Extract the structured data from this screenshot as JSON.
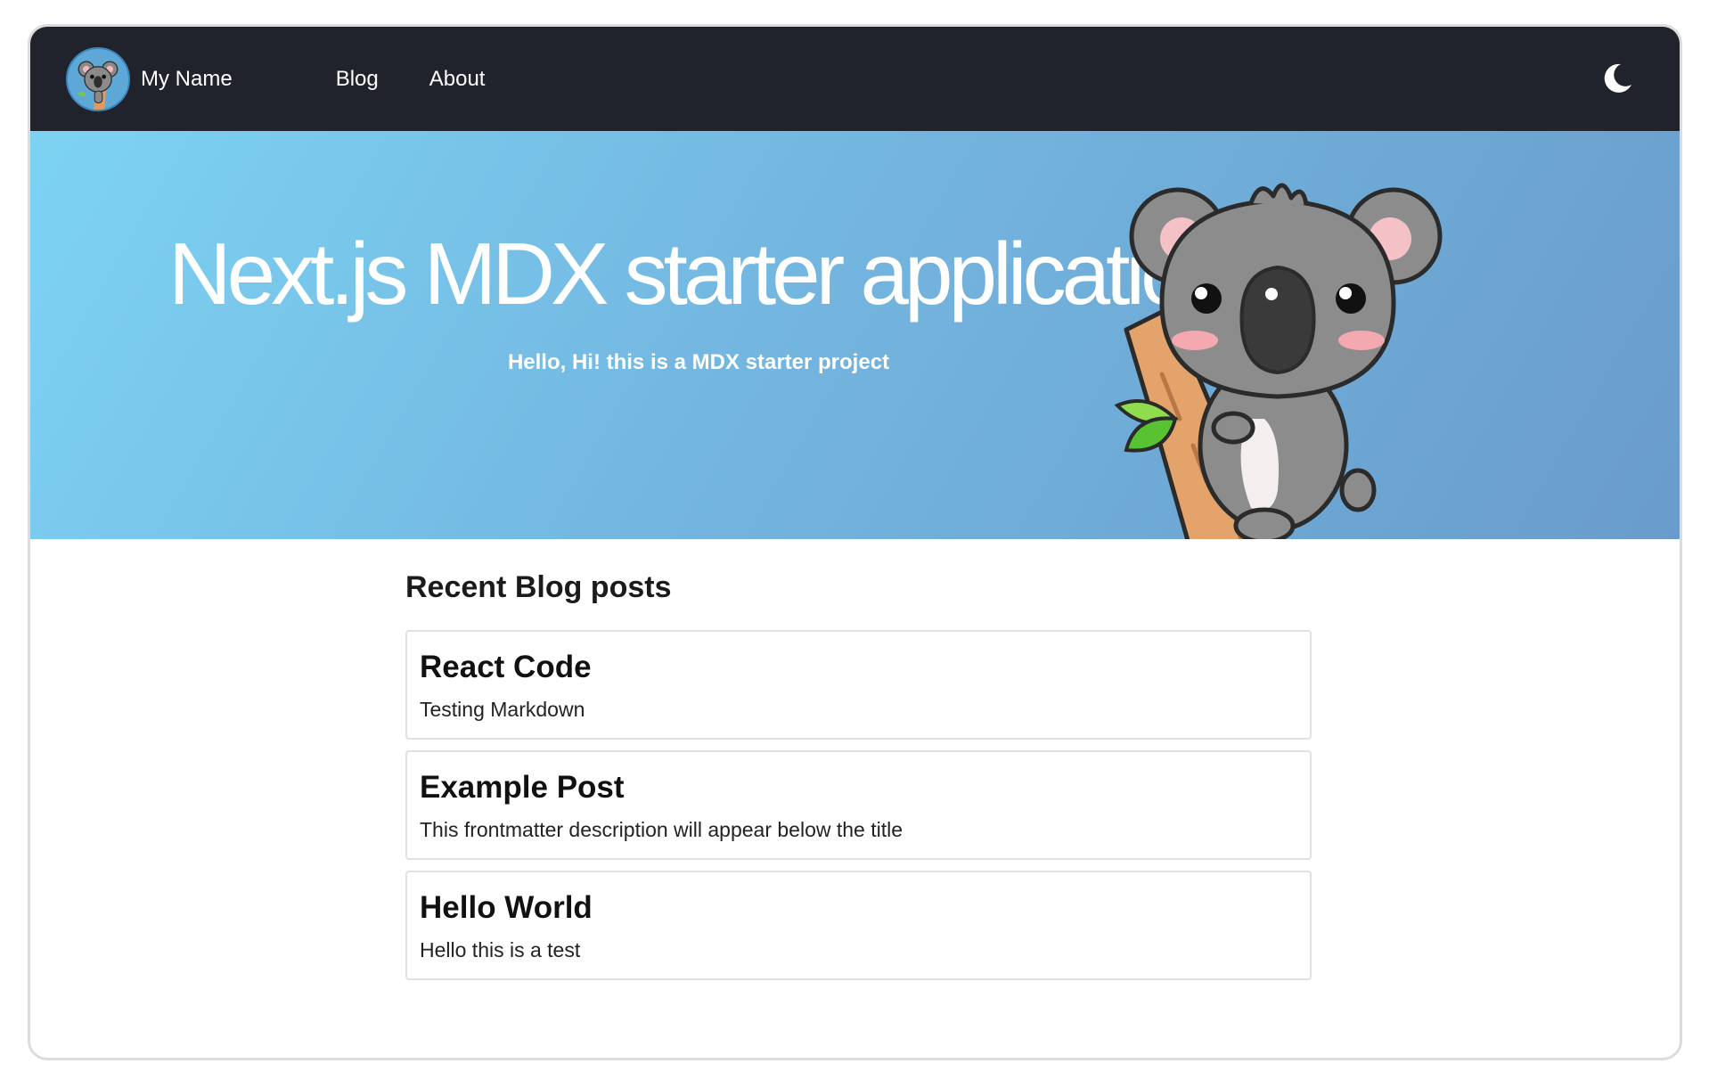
{
  "navbar": {
    "brand_name": "My Name",
    "links": [
      {
        "label": "Blog"
      },
      {
        "label": "About"
      }
    ],
    "theme_icon": "moon-icon",
    "background": "#21232c"
  },
  "hero": {
    "title": "Next.js MDX starter application",
    "subtitle": "Hello, Hi! this is a MDX starter project",
    "gradient": [
      "#7dd3f3",
      "#6a9ccb"
    ],
    "illustration": "koala-icon"
  },
  "recent_posts": {
    "heading": "Recent Blog posts",
    "posts": [
      {
        "title": "React Code",
        "description": "Testing Markdown"
      },
      {
        "title": "Example Post",
        "description": "This frontmatter description will appear below the title"
      },
      {
        "title": "Hello World",
        "description": "Hello this is a test"
      }
    ]
  }
}
